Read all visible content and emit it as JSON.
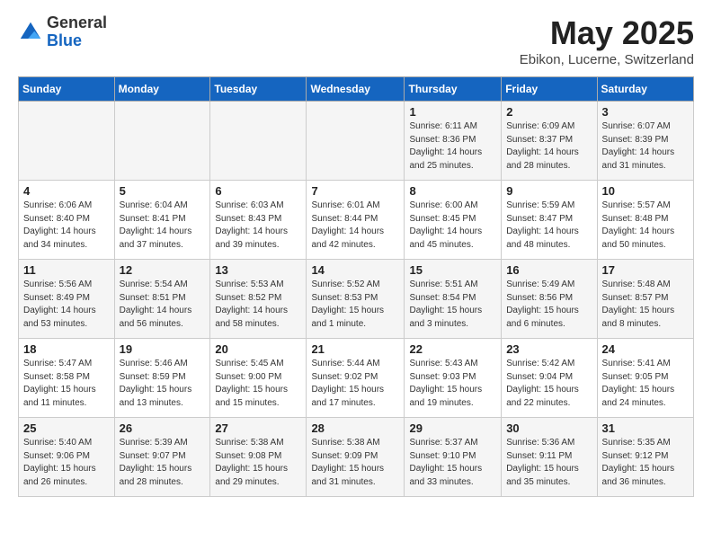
{
  "header": {
    "logo": {
      "general": "General",
      "blue": "Blue"
    },
    "title": "May 2025",
    "subtitle": "Ebikon, Lucerne, Switzerland"
  },
  "days_of_week": [
    "Sunday",
    "Monday",
    "Tuesday",
    "Wednesday",
    "Thursday",
    "Friday",
    "Saturday"
  ],
  "weeks": [
    [
      {
        "day": "",
        "sunrise": "",
        "sunset": "",
        "daylight": ""
      },
      {
        "day": "",
        "sunrise": "",
        "sunset": "",
        "daylight": ""
      },
      {
        "day": "",
        "sunrise": "",
        "sunset": "",
        "daylight": ""
      },
      {
        "day": "",
        "sunrise": "",
        "sunset": "",
        "daylight": ""
      },
      {
        "day": "1",
        "sunrise": "Sunrise: 6:11 AM",
        "sunset": "Sunset: 8:36 PM",
        "daylight": "Daylight: 14 hours and 25 minutes."
      },
      {
        "day": "2",
        "sunrise": "Sunrise: 6:09 AM",
        "sunset": "Sunset: 8:37 PM",
        "daylight": "Daylight: 14 hours and 28 minutes."
      },
      {
        "day": "3",
        "sunrise": "Sunrise: 6:07 AM",
        "sunset": "Sunset: 8:39 PM",
        "daylight": "Daylight: 14 hours and 31 minutes."
      }
    ],
    [
      {
        "day": "4",
        "sunrise": "Sunrise: 6:06 AM",
        "sunset": "Sunset: 8:40 PM",
        "daylight": "Daylight: 14 hours and 34 minutes."
      },
      {
        "day": "5",
        "sunrise": "Sunrise: 6:04 AM",
        "sunset": "Sunset: 8:41 PM",
        "daylight": "Daylight: 14 hours and 37 minutes."
      },
      {
        "day": "6",
        "sunrise": "Sunrise: 6:03 AM",
        "sunset": "Sunset: 8:43 PM",
        "daylight": "Daylight: 14 hours and 39 minutes."
      },
      {
        "day": "7",
        "sunrise": "Sunrise: 6:01 AM",
        "sunset": "Sunset: 8:44 PM",
        "daylight": "Daylight: 14 hours and 42 minutes."
      },
      {
        "day": "8",
        "sunrise": "Sunrise: 6:00 AM",
        "sunset": "Sunset: 8:45 PM",
        "daylight": "Daylight: 14 hours and 45 minutes."
      },
      {
        "day": "9",
        "sunrise": "Sunrise: 5:59 AM",
        "sunset": "Sunset: 8:47 PM",
        "daylight": "Daylight: 14 hours and 48 minutes."
      },
      {
        "day": "10",
        "sunrise": "Sunrise: 5:57 AM",
        "sunset": "Sunset: 8:48 PM",
        "daylight": "Daylight: 14 hours and 50 minutes."
      }
    ],
    [
      {
        "day": "11",
        "sunrise": "Sunrise: 5:56 AM",
        "sunset": "Sunset: 8:49 PM",
        "daylight": "Daylight: 14 hours and 53 minutes."
      },
      {
        "day": "12",
        "sunrise": "Sunrise: 5:54 AM",
        "sunset": "Sunset: 8:51 PM",
        "daylight": "Daylight: 14 hours and 56 minutes."
      },
      {
        "day": "13",
        "sunrise": "Sunrise: 5:53 AM",
        "sunset": "Sunset: 8:52 PM",
        "daylight": "Daylight: 14 hours and 58 minutes."
      },
      {
        "day": "14",
        "sunrise": "Sunrise: 5:52 AM",
        "sunset": "Sunset: 8:53 PM",
        "daylight": "Daylight: 15 hours and 1 minute."
      },
      {
        "day": "15",
        "sunrise": "Sunrise: 5:51 AM",
        "sunset": "Sunset: 8:54 PM",
        "daylight": "Daylight: 15 hours and 3 minutes."
      },
      {
        "day": "16",
        "sunrise": "Sunrise: 5:49 AM",
        "sunset": "Sunset: 8:56 PM",
        "daylight": "Daylight: 15 hours and 6 minutes."
      },
      {
        "day": "17",
        "sunrise": "Sunrise: 5:48 AM",
        "sunset": "Sunset: 8:57 PM",
        "daylight": "Daylight: 15 hours and 8 minutes."
      }
    ],
    [
      {
        "day": "18",
        "sunrise": "Sunrise: 5:47 AM",
        "sunset": "Sunset: 8:58 PM",
        "daylight": "Daylight: 15 hours and 11 minutes."
      },
      {
        "day": "19",
        "sunrise": "Sunrise: 5:46 AM",
        "sunset": "Sunset: 8:59 PM",
        "daylight": "Daylight: 15 hours and 13 minutes."
      },
      {
        "day": "20",
        "sunrise": "Sunrise: 5:45 AM",
        "sunset": "Sunset: 9:00 PM",
        "daylight": "Daylight: 15 hours and 15 minutes."
      },
      {
        "day": "21",
        "sunrise": "Sunrise: 5:44 AM",
        "sunset": "Sunset: 9:02 PM",
        "daylight": "Daylight: 15 hours and 17 minutes."
      },
      {
        "day": "22",
        "sunrise": "Sunrise: 5:43 AM",
        "sunset": "Sunset: 9:03 PM",
        "daylight": "Daylight: 15 hours and 19 minutes."
      },
      {
        "day": "23",
        "sunrise": "Sunrise: 5:42 AM",
        "sunset": "Sunset: 9:04 PM",
        "daylight": "Daylight: 15 hours and 22 minutes."
      },
      {
        "day": "24",
        "sunrise": "Sunrise: 5:41 AM",
        "sunset": "Sunset: 9:05 PM",
        "daylight": "Daylight: 15 hours and 24 minutes."
      }
    ],
    [
      {
        "day": "25",
        "sunrise": "Sunrise: 5:40 AM",
        "sunset": "Sunset: 9:06 PM",
        "daylight": "Daylight: 15 hours and 26 minutes."
      },
      {
        "day": "26",
        "sunrise": "Sunrise: 5:39 AM",
        "sunset": "Sunset: 9:07 PM",
        "daylight": "Daylight: 15 hours and 28 minutes."
      },
      {
        "day": "27",
        "sunrise": "Sunrise: 5:38 AM",
        "sunset": "Sunset: 9:08 PM",
        "daylight": "Daylight: 15 hours and 29 minutes."
      },
      {
        "day": "28",
        "sunrise": "Sunrise: 5:38 AM",
        "sunset": "Sunset: 9:09 PM",
        "daylight": "Daylight: 15 hours and 31 minutes."
      },
      {
        "day": "29",
        "sunrise": "Sunrise: 5:37 AM",
        "sunset": "Sunset: 9:10 PM",
        "daylight": "Daylight: 15 hours and 33 minutes."
      },
      {
        "day": "30",
        "sunrise": "Sunrise: 5:36 AM",
        "sunset": "Sunset: 9:11 PM",
        "daylight": "Daylight: 15 hours and 35 minutes."
      },
      {
        "day": "31",
        "sunrise": "Sunrise: 5:35 AM",
        "sunset": "Sunset: 9:12 PM",
        "daylight": "Daylight: 15 hours and 36 minutes."
      }
    ]
  ]
}
